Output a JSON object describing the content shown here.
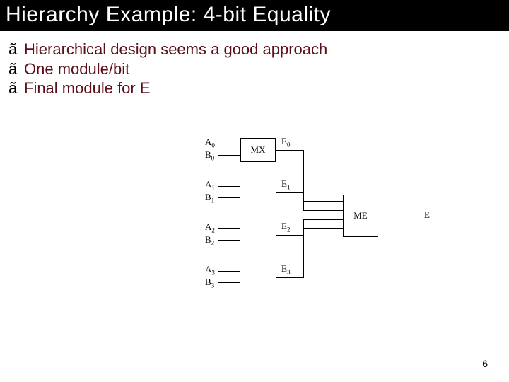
{
  "title": "Hierarchy Example:  4-bit Equality",
  "bullets": {
    "b0": {
      "mark": "ã",
      "text": "Hierarchical design seems a good approach"
    },
    "b1": {
      "mark": "ã",
      "text": "One module/bit"
    },
    "b2": {
      "mark": "ã",
      "text": "Final module for E"
    }
  },
  "diagram": {
    "mx_label": "MX",
    "me_label": "ME",
    "inputs": {
      "a0": "A",
      "a0s": "0",
      "b0": "B",
      "b0s": "0",
      "a1": "A",
      "a1s": "1",
      "b1": "B",
      "b1s": "1",
      "a2": "A",
      "a2s": "2",
      "b2": "B",
      "b2s": "2",
      "a3": "A",
      "a3s": "3",
      "b3": "B",
      "b3s": "3"
    },
    "mid": {
      "e0": "E",
      "e0s": "0",
      "e1": "E",
      "e1s": "1",
      "e2": "E",
      "e2s": "2",
      "e3": "E",
      "e3s": "3"
    },
    "out": "E"
  },
  "page": "6"
}
